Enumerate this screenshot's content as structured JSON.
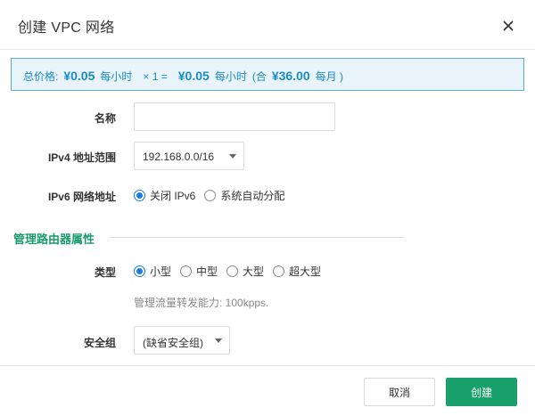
{
  "dialog": {
    "title": "创建 VPC 网络"
  },
  "price": {
    "total_label": "总价格:",
    "unit_price": "¥0.05",
    "unit_period": "每小时",
    "multiplier": "× 1 =",
    "total_price": "¥0.05",
    "total_period": "每小时",
    "monthly_prefix": "(合",
    "monthly_price": "¥36.00",
    "monthly_suffix": "每月 )"
  },
  "form": {
    "name_label": "名称",
    "name_value": "",
    "ipv4_label": "IPv4 地址范围",
    "ipv4_value": "192.168.0.0/16",
    "ipv6_label": "IPv6 网络地址",
    "ipv6_options": [
      {
        "label": "关闭 IPv6",
        "selected": true
      },
      {
        "label": "系统自动分配",
        "selected": false
      }
    ]
  },
  "router": {
    "section_title": "管理路由器属性",
    "type_label": "类型",
    "type_options": [
      {
        "label": "小型",
        "selected": true
      },
      {
        "label": "中型",
        "selected": false
      },
      {
        "label": "大型",
        "selected": false
      },
      {
        "label": "超大型",
        "selected": false
      }
    ],
    "hint": "管理流量转发能力: 100kpps.",
    "security_group_label": "安全组",
    "security_group_value": "(缺省安全组)"
  },
  "footer": {
    "cancel_label": "取消",
    "create_label": "创建"
  },
  "colors": {
    "accent_green": "#1aa06c",
    "price_blue": "#1a8bc4",
    "radio_blue": "#1a7ce6"
  }
}
